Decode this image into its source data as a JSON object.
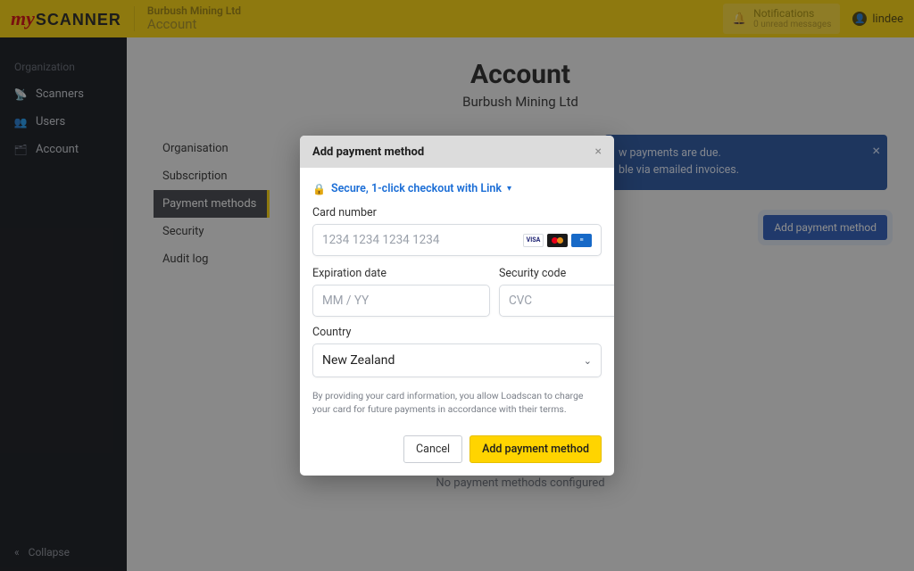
{
  "brand": {
    "my": "my",
    "scanner": "SCANNER"
  },
  "topbar": {
    "org": "Burbush Mining Ltd",
    "page": "Account",
    "notifications": {
      "title": "Notifications",
      "sub": "0 unread messages"
    },
    "user": "lindee"
  },
  "sidebar": {
    "heading": "Organization",
    "items": [
      {
        "label": "Scanners"
      },
      {
        "label": "Users"
      },
      {
        "label": "Account"
      }
    ],
    "collapse": "Collapse"
  },
  "page": {
    "title": "Account",
    "subtitle": "Burbush Mining Ltd"
  },
  "subnav": {
    "items": [
      {
        "label": "Organisation"
      },
      {
        "label": "Subscription"
      },
      {
        "label": "Payment methods",
        "active": true
      },
      {
        "label": "Security"
      },
      {
        "label": "Audit log"
      }
    ]
  },
  "alert": {
    "line1_suffix": "w payments are due.",
    "line2_suffix": "ble via emailed invoices."
  },
  "pm": {
    "add_button": "Add payment method",
    "empty": "No payment methods configured"
  },
  "modal": {
    "title": "Add payment method",
    "secure": "Secure, 1-click checkout with Link",
    "card_label": "Card number",
    "card_placeholder": "1234 1234 1234 1234",
    "exp_label": "Expiration date",
    "exp_placeholder": "MM / YY",
    "cvc_label": "Security code",
    "cvc_placeholder": "CVC",
    "country_label": "Country",
    "country_value": "New Zealand",
    "disclaimer": "By providing your card information, you allow Loadscan to charge your card for future payments in accordance with their terms.",
    "cancel": "Cancel",
    "submit": "Add payment method",
    "brands": {
      "visa": "VISA",
      "amex": "≡"
    }
  }
}
